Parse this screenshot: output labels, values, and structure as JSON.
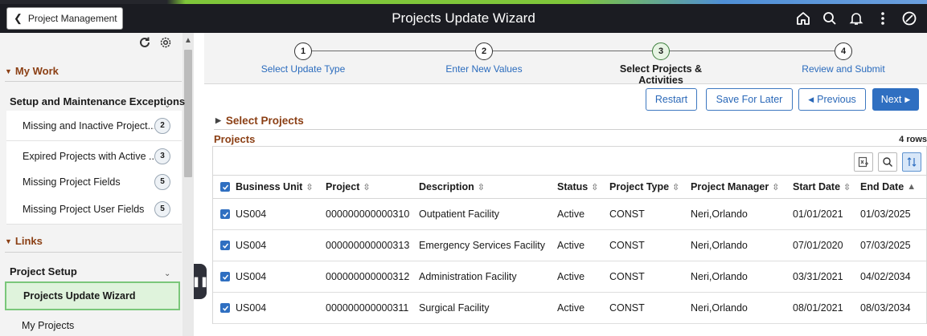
{
  "header": {
    "back_label": "Project Management",
    "title": "Projects Update Wizard",
    "icons": [
      "home-icon",
      "search-icon",
      "bell-icon",
      "more-icon",
      "nav-compass-icon"
    ]
  },
  "sidebar": {
    "my_work": {
      "label": "My Work",
      "group": "Setup and Maintenance Exceptions",
      "items": [
        {
          "label": "Missing and Inactive Project...",
          "count": "2"
        },
        {
          "label": "Expired Projects with Active ...",
          "count": "3"
        },
        {
          "label": "Missing Project Fields",
          "count": "5"
        },
        {
          "label": "Missing Project User Fields",
          "count": "5"
        }
      ]
    },
    "links": {
      "label": "Links",
      "group": "Project Setup",
      "active_item": "Projects Update Wizard",
      "items": [
        "My Projects"
      ]
    }
  },
  "train": {
    "steps": [
      {
        "num": "1",
        "label": "Select Update Type"
      },
      {
        "num": "2",
        "label": "Enter New Values"
      },
      {
        "num": "3",
        "label": "Select Projects & Activities"
      },
      {
        "num": "4",
        "label": "Review and Submit"
      }
    ]
  },
  "toolbar": {
    "restart": "Restart",
    "save_later": "Save For Later",
    "previous": "Previous",
    "next": "Next"
  },
  "section": {
    "select_projects": "Select Projects",
    "grid_title": "Projects",
    "row_count": "4 rows"
  },
  "table": {
    "columns": [
      "Business Unit",
      "Project",
      "Description",
      "Status",
      "Project Type",
      "Project Manager",
      "Start Date",
      "End Date"
    ],
    "rows": [
      [
        "US004",
        "000000000000310",
        "Outpatient Facility",
        "Active",
        "CONST",
        "Neri,Orlando",
        "01/01/2021",
        "01/03/2025"
      ],
      [
        "US004",
        "000000000000313",
        "Emergency Services Facility",
        "Active",
        "CONST",
        "Neri,Orlando",
        "07/01/2020",
        "07/03/2025"
      ],
      [
        "US004",
        "000000000000312",
        "Administration Facility",
        "Active",
        "CONST",
        "Neri,Orlando",
        "03/31/2021",
        "04/02/2034"
      ],
      [
        "US004",
        "000000000000311",
        "Surgical Facility",
        "Active",
        "CONST",
        "Neri,Orlando",
        "08/01/2021",
        "08/03/2034"
      ]
    ]
  },
  "colors": {
    "accent_brown": "#8b3f14",
    "link_blue": "#2a6bbd",
    "primary_blue": "#2f6fc1",
    "banner": "#1b1c22"
  }
}
